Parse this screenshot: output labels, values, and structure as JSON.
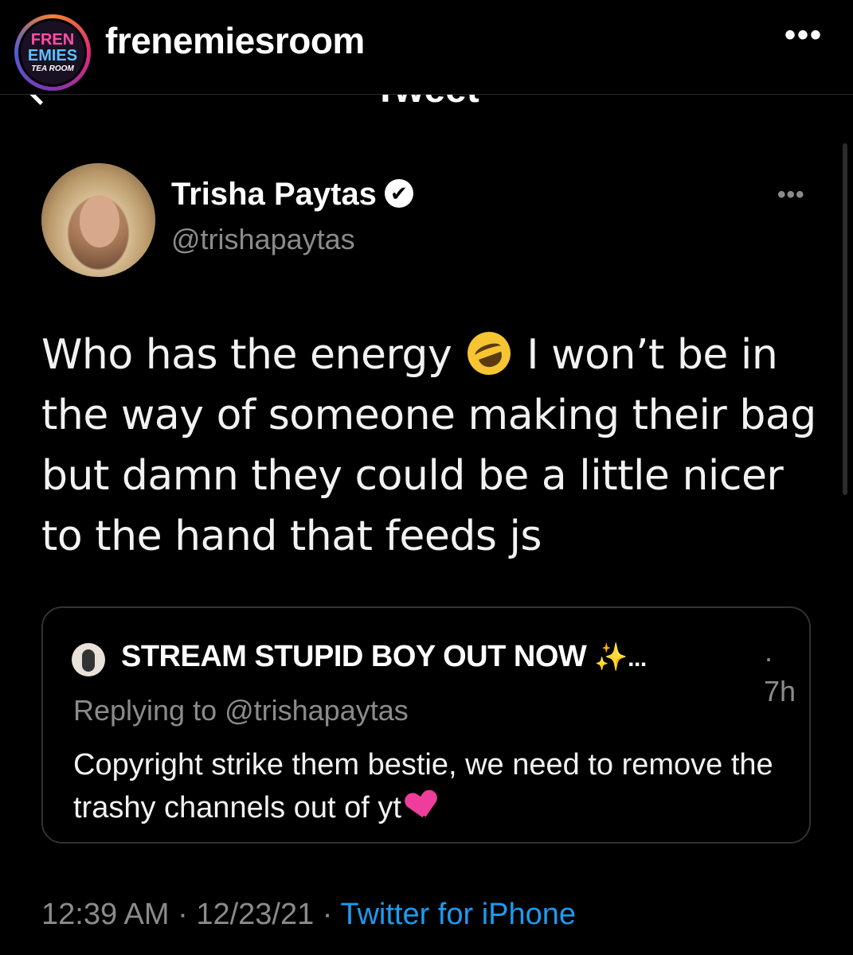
{
  "instagram": {
    "username": "frenemiesroom",
    "more_label": "•••",
    "avatar_logo": {
      "line1": "FREN",
      "line2": "EMIES",
      "line3": "TEA ROOM"
    }
  },
  "twitter_topbar": {
    "title": "Tweet"
  },
  "tweet": {
    "author_name": "Trisha Paytas",
    "verified_icon": "✔",
    "handle": "@trishapaytas",
    "more_label": "•••",
    "text_part1": "Who has the energy",
    "emoji1": "rolling-on-floor-laughing-emoji",
    "text_part2": "I won’t be in the way of someone making their bag but damn they could be a little nicer to the hand that feeds js",
    "timestamp": "12:39 AM · 12/23/21 · ",
    "source": "Twitter for iPhone"
  },
  "quoted_tweet": {
    "author_name": "STREAM STUPID BOY OUT NOW",
    "sparkles": "✨",
    "ellipsis": "...",
    "time": "· 7h",
    "replying": "Replying to @trishapaytas",
    "text": "Copyright strike them bestie, we need to remove the trashy channels out of yt",
    "emoji": "sparkling-heart-emoji"
  },
  "colors": {
    "background": "#000000",
    "secondary_text": "#8b8b8b",
    "link": "#1d9bf0"
  }
}
